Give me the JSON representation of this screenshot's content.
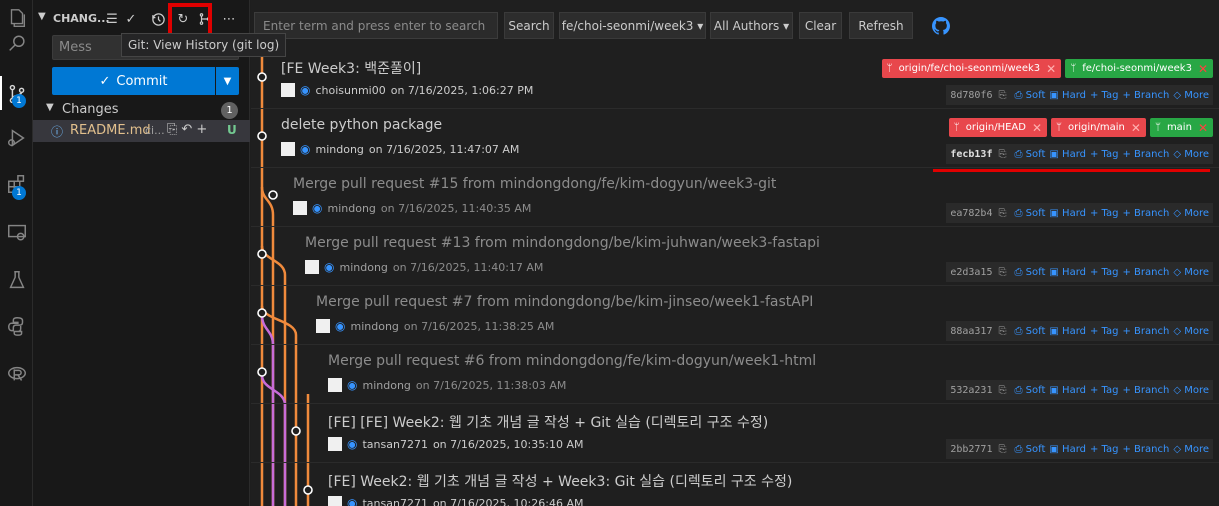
{
  "sidebar": {
    "title": "CHANG...",
    "message_placeholder": "Mess",
    "tooltip": "Git: View History (git log)",
    "commit_label": "Commit",
    "changes_label": "Changes",
    "changes_count": "1",
    "file": {
      "name": "README.md",
      "dir": "ci...",
      "status": "U"
    }
  },
  "activity": {
    "scm_badge": "1",
    "ext_badge": "1"
  },
  "toolbar": {
    "search_placeholder": "Enter term and press enter to search",
    "search_label": "Search",
    "branch_label": "fe/choi-seonmi/week3 ▾",
    "authors_label": "All Authors ▾",
    "clear_label": "Clear",
    "refresh_label": "Refresh"
  },
  "actions": {
    "soft": "Soft",
    "hard": "Hard",
    "tag": "Tag",
    "branch": "Branch",
    "more": "More"
  },
  "commits": [
    {
      "title": "[FE Week3: 백준풀이]",
      "author": "choisunmi00",
      "date": "on 7/16/2025, 1:06:27 PM",
      "hash": "8d780f6",
      "refs": [
        {
          "label": "origin/fe/choi-seonmi/week3",
          "color": "red"
        },
        {
          "label": "fe/choi-seonmi/week3",
          "color": "green"
        }
      ]
    },
    {
      "title": "delete python package",
      "author": "mindong",
      "date": "on 7/16/2025, 11:47:07 AM",
      "hash": "fecb13f",
      "refs": [
        {
          "label": "origin/HEAD",
          "color": "red"
        },
        {
          "label": "origin/main",
          "color": "red"
        },
        {
          "label": "main",
          "color": "green"
        }
      ]
    },
    {
      "title": "Merge pull request #15 from mindongdong/fe/kim-dogyun/week3-git",
      "author": "mindong",
      "date": "on 7/16/2025, 11:40:35 AM",
      "hash": "ea782b4",
      "refs": []
    },
    {
      "title": "Merge pull request #13 from mindongdong/be/kim-juhwan/week3-fastapi",
      "author": "mindong",
      "date": "on 7/16/2025, 11:40:17 AM",
      "hash": "e2d3a15",
      "refs": []
    },
    {
      "title": "Merge pull request #7 from mindongdong/be/kim-jinseo/week1-fastAPI",
      "author": "mindong",
      "date": "on 7/16/2025, 11:38:25 AM",
      "hash": "88aa317",
      "refs": []
    },
    {
      "title": "Merge pull request #6 from mindongdong/fe/kim-dogyun/week1-html",
      "author": "mindong",
      "date": "on 7/16/2025, 11:38:03 AM",
      "hash": "532a231",
      "refs": []
    },
    {
      "title": "[FE] [FE] Week2: 웹 기초 개념 글 작성 + Git 실습 (디렉토리 구조 수정)",
      "author": "tansan7271",
      "date": "on 7/16/2025, 10:35:10 AM",
      "hash": "2bb2771",
      "refs": []
    },
    {
      "title": "[FE] Week2: 웹 기초 개념 글 작성 + Week3: Git 실습 (디렉토리 구조 수정)",
      "author": "tansan7271",
      "date": "on 7/16/2025, 10:26:46 AM",
      "hash": "",
      "refs": []
    }
  ],
  "colors": {
    "accent": "#0078d4",
    "highlight": "#e00000",
    "lane_orange": "#f08a3c",
    "lane_purple": "#c86cd8",
    "ref_red": "#e8474c",
    "ref_green": "#28a745"
  }
}
